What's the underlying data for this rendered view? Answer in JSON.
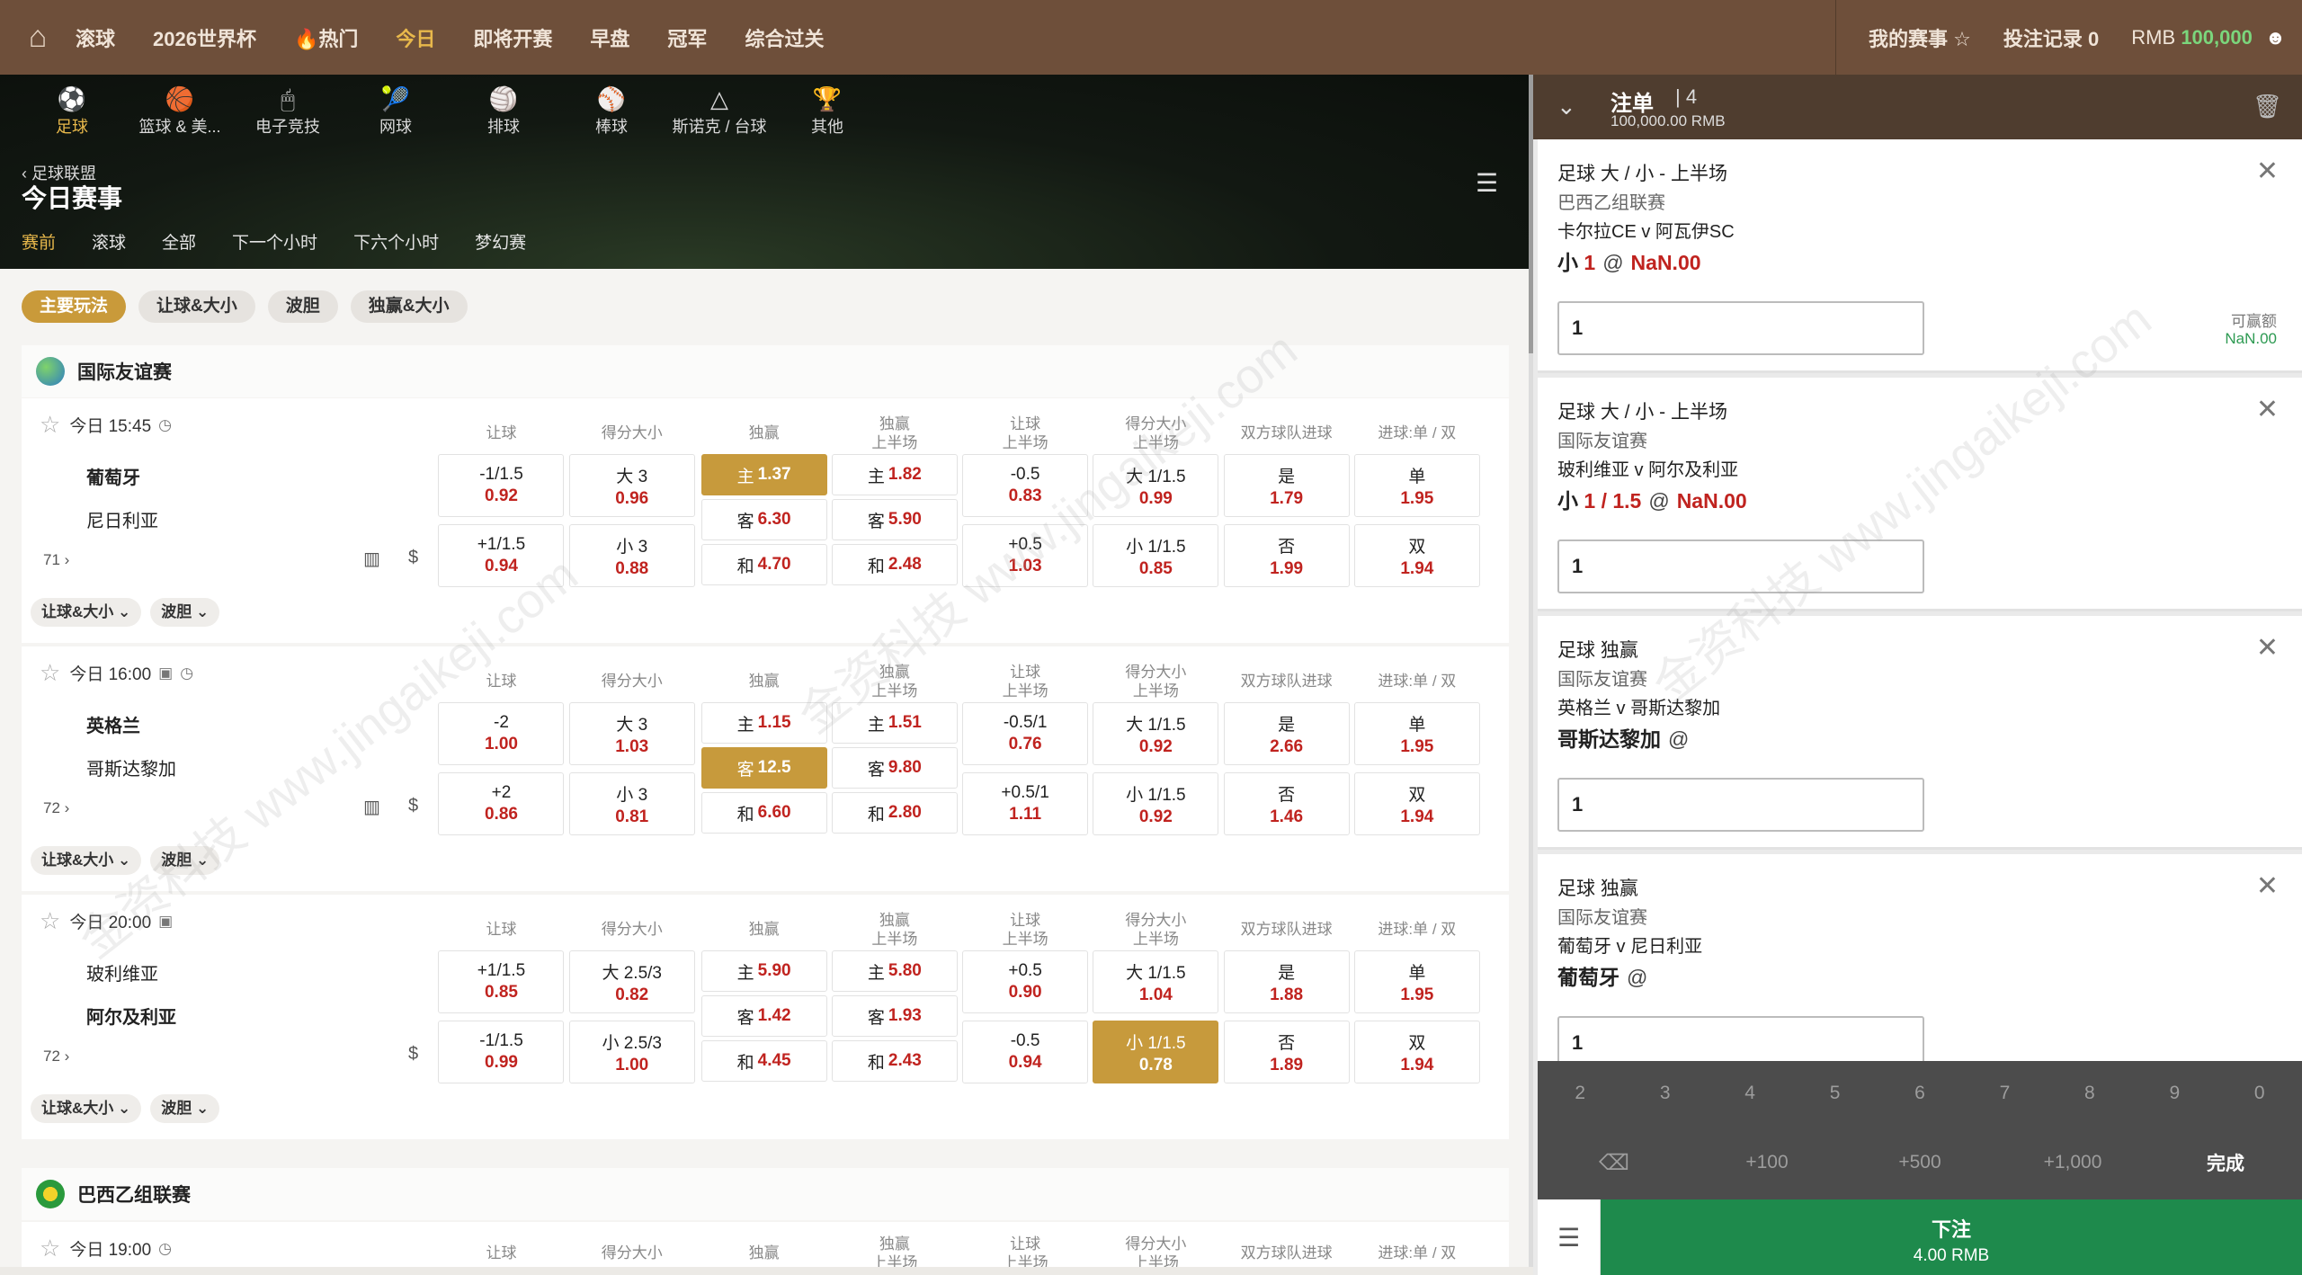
{
  "topnav": {
    "items": [
      {
        "label": "滚球",
        "active": false
      },
      {
        "label": "2026世界杯",
        "active": false
      },
      {
        "label": "🔥热门",
        "active": false
      },
      {
        "label": "今日",
        "active": true
      },
      {
        "label": "即将开赛",
        "active": false
      },
      {
        "label": "早盘",
        "active": false
      },
      {
        "label": "冠军",
        "active": false
      },
      {
        "label": "综合过关",
        "active": false
      }
    ],
    "my_matches": "我的赛事",
    "bet_records": "投注记录",
    "bet_records_count": "0",
    "currency": "RMB",
    "balance": "100,000"
  },
  "sports": [
    {
      "label": "足球",
      "icon": "soccer-icon",
      "glyph": "⚽",
      "active": true
    },
    {
      "label": "篮球 & 美...",
      "icon": "basketball-icon",
      "glyph": "🏀",
      "active": false
    },
    {
      "label": "电子竞技",
      "icon": "mouse-icon",
      "glyph": "🖱",
      "active": false
    },
    {
      "label": "网球",
      "icon": "tennis-icon",
      "glyph": "🎾",
      "active": false
    },
    {
      "label": "排球",
      "icon": "volleyball-icon",
      "glyph": "🏐",
      "active": false
    },
    {
      "label": "棒球",
      "icon": "baseball-icon",
      "glyph": "⚾",
      "active": false
    },
    {
      "label": "斯诺克 / 台球",
      "icon": "snooker-icon",
      "glyph": "△",
      "active": false
    },
    {
      "label": "其他",
      "icon": "trophy-icon",
      "glyph": "🏆",
      "active": false
    }
  ],
  "header": {
    "back_label": "足球联盟",
    "title": "今日赛事",
    "subtabs": [
      {
        "label": "赛前",
        "active": true
      },
      {
        "label": "滚球",
        "active": false
      },
      {
        "label": "全部",
        "active": false
      },
      {
        "label": "下一个小时",
        "active": false
      },
      {
        "label": "下六个小时",
        "active": false
      },
      {
        "label": "梦幻赛",
        "active": false
      }
    ]
  },
  "pills": [
    {
      "label": "主要玩法",
      "active": true
    },
    {
      "label": "让球&大小",
      "active": false
    },
    {
      "label": "波胆",
      "active": false
    },
    {
      "label": "独赢&大小",
      "active": false
    }
  ],
  "columns": {
    "handicap": "让球",
    "ou": "得分大小",
    "mw": "独赢",
    "mw_half_1": "独赢",
    "mw_half_2": "上半场",
    "hc_half_1": "让球",
    "hc_half_2": "上半场",
    "ou_half_1": "得分大小",
    "ou_half_2": "上半场",
    "btts": "双方球队进球",
    "oe": "进球:单 / 双"
  },
  "leagues": [
    {
      "name": "国际友谊赛"
    },
    {
      "name": "巴西乙组联赛"
    }
  ],
  "matches": [
    {
      "time": "今日 15:45",
      "home": "葡萄牙",
      "away": "尼日利亚",
      "more": "71",
      "hc": [
        {
          "line": "-1/1.5",
          "odd": "0.92"
        },
        {
          "line": "+1/1.5",
          "odd": "0.94"
        }
      ],
      "ou": [
        {
          "line": "大 3",
          "odd": "0.96"
        },
        {
          "line": "小 3",
          "odd": "0.88"
        }
      ],
      "mw": [
        {
          "line": "主",
          "odd": "1.37"
        },
        {
          "line": "客",
          "odd": "6.30"
        },
        {
          "line": "和",
          "odd": "4.70"
        }
      ],
      "mwh": [
        {
          "line": "主",
          "odd": "1.82"
        },
        {
          "line": "客",
          "odd": "5.90"
        },
        {
          "line": "和",
          "odd": "2.48"
        }
      ],
      "hch": [
        {
          "line": "-0.5",
          "odd": "0.83"
        },
        {
          "line": "+0.5",
          "odd": "1.03"
        }
      ],
      "ouh": [
        {
          "line": "大 1/1.5",
          "odd": "0.99"
        },
        {
          "line": "小 1/1.5",
          "odd": "0.85"
        }
      ],
      "btts": [
        {
          "line": "是",
          "odd": "1.79"
        },
        {
          "line": "否",
          "odd": "1.99"
        }
      ],
      "oe": [
        {
          "line": "单",
          "odd": "1.95"
        },
        {
          "line": "双",
          "odd": "1.94"
        }
      ],
      "tags": [
        "让球&大小",
        "波胆"
      ]
    },
    {
      "time": "今日 16:00",
      "home": "英格兰",
      "away": "哥斯达黎加",
      "more": "72",
      "hc": [
        {
          "line": "-2",
          "odd": "1.00"
        },
        {
          "line": "+2",
          "odd": "0.86"
        }
      ],
      "ou": [
        {
          "line": "大 3",
          "odd": "1.03"
        },
        {
          "line": "小 3",
          "odd": "0.81"
        }
      ],
      "mw": [
        {
          "line": "主",
          "odd": "1.15"
        },
        {
          "line": "客",
          "odd": "12.5"
        },
        {
          "line": "和",
          "odd": "6.60"
        }
      ],
      "mwh": [
        {
          "line": "主",
          "odd": "1.51"
        },
        {
          "line": "客",
          "odd": "9.80"
        },
        {
          "line": "和",
          "odd": "2.80"
        }
      ],
      "hch": [
        {
          "line": "-0.5/1",
          "odd": "0.76"
        },
        {
          "line": "+0.5/1",
          "odd": "1.11"
        }
      ],
      "ouh": [
        {
          "line": "大 1/1.5",
          "odd": "0.92"
        },
        {
          "line": "小 1/1.5",
          "odd": "0.92"
        }
      ],
      "btts": [
        {
          "line": "是",
          "odd": "2.66"
        },
        {
          "line": "否",
          "odd": "1.46"
        }
      ],
      "oe": [
        {
          "line": "单",
          "odd": "1.95"
        },
        {
          "line": "双",
          "odd": "1.94"
        }
      ],
      "tags": [
        "让球&大小",
        "波胆"
      ]
    },
    {
      "time": "今日 20:00",
      "home": "玻利维亚",
      "away": "阿尔及利亚",
      "more": "72",
      "hc": [
        {
          "line": "+1/1.5",
          "odd": "0.85"
        },
        {
          "line": "-1/1.5",
          "odd": "0.99"
        }
      ],
      "ou": [
        {
          "line": "大 2.5/3",
          "odd": "0.82"
        },
        {
          "line": "小 2.5/3",
          "odd": "1.00"
        }
      ],
      "mw": [
        {
          "line": "主",
          "odd": "5.90"
        },
        {
          "line": "客",
          "odd": "1.42"
        },
        {
          "line": "和",
          "odd": "4.45"
        }
      ],
      "mwh": [
        {
          "line": "主",
          "odd": "5.80"
        },
        {
          "line": "客",
          "odd": "1.93"
        },
        {
          "line": "和",
          "odd": "2.43"
        }
      ],
      "hch": [
        {
          "line": "+0.5",
          "odd": "0.90"
        },
        {
          "line": "-0.5",
          "odd": "0.94"
        }
      ],
      "ouh": [
        {
          "line": "大 1/1.5",
          "odd": "1.04"
        },
        {
          "line": "小 1/1.5",
          "odd": "0.78"
        }
      ],
      "btts": [
        {
          "line": "是",
          "odd": "1.88"
        },
        {
          "line": "否",
          "odd": "1.89"
        }
      ],
      "oe": [
        {
          "line": "单",
          "odd": "1.95"
        },
        {
          "line": "双",
          "odd": "1.94"
        }
      ],
      "tags": [
        "让球&大小",
        "波胆"
      ]
    },
    {
      "time": "今日 19:00"
    }
  ],
  "betslip": {
    "title": "注单",
    "count": "4",
    "balance": "100,000.00 RMB",
    "bets": [
      {
        "market": "足球 大 / 小 - 上半场",
        "league": "巴西乙组联赛",
        "matchup": "卡尔拉CE v 阿瓦伊SC",
        "pick": "小",
        "line": "1",
        "at": "@",
        "odds": "NaN.00",
        "stake": "1",
        "win_label": "可赢额",
        "win_val": "NaN.00"
      },
      {
        "market": "足球 大 / 小 - 上半场",
        "league": "国际友谊赛",
        "matchup": "玻利维亚 v 阿尔及利亚",
        "pick": "小",
        "line": "1 / 1.5",
        "at": "@",
        "odds": "NaN.00",
        "stake": "1"
      },
      {
        "market": "足球 独赢",
        "league": "国际友谊赛",
        "matchup": "英格兰 v 哥斯达黎加",
        "pick": "哥斯达黎加",
        "line": "",
        "at": "@",
        "odds": "",
        "stake": "1"
      },
      {
        "market": "足球 独赢",
        "league": "国际友谊赛",
        "matchup": "葡萄牙 v 尼日利亚",
        "pick": "葡萄牙",
        "line": "",
        "at": "@",
        "odds": "",
        "stake": "1"
      }
    ],
    "keypad_nums": [
      "2",
      "3",
      "4",
      "5",
      "6",
      "7",
      "8",
      "9",
      "0"
    ],
    "keypad_quick": [
      "+100",
      "+500",
      "+1,000"
    ],
    "done": "完成",
    "place_label": "下注",
    "place_amount": "4.00 RMB"
  },
  "watermark": "金资科技 www.jingaikeji.com"
}
